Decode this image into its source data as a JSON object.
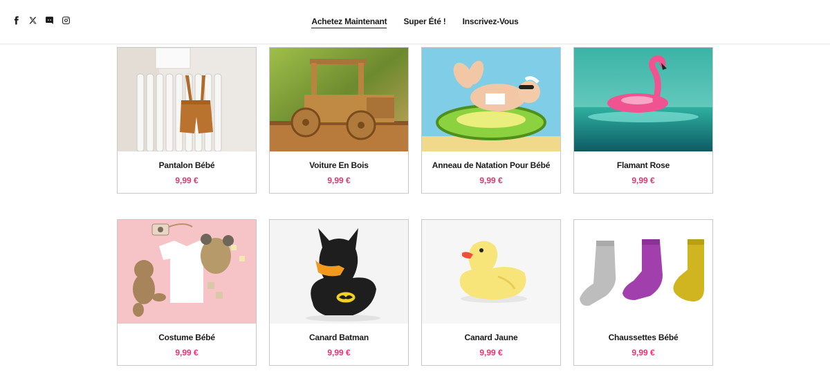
{
  "colors": {
    "price": "#e8336d",
    "text": "#1a1a1a",
    "border": "#c9c9c9"
  },
  "social": [
    {
      "icon": "facebook-icon"
    },
    {
      "icon": "x-twitter-icon"
    },
    {
      "icon": "discord-icon"
    },
    {
      "icon": "instagram-icon"
    }
  ],
  "nav": {
    "items": [
      {
        "label": "Achetez Maintenant",
        "active": true
      },
      {
        "label": "Super Été !"
      },
      {
        "label": "Inscrivez-Vous"
      }
    ]
  },
  "products": [
    {
      "name": "Pantalon Bébé",
      "price": "9,99 €",
      "image": "brown-shorts-on-radiator"
    },
    {
      "name": "Voiture En Bois",
      "price": "9,99 €",
      "image": "wooden-toy-truck"
    },
    {
      "name": "Anneau de Natation Pour Bébé",
      "price": "9,99 €",
      "image": "baby-on-swim-ring"
    },
    {
      "name": "Flamant Rose",
      "price": "9,99 €",
      "image": "pink-flamingo-float"
    },
    {
      "name": "Costume Bébé",
      "price": "9,99 €",
      "image": "baby-outfit-flatlay"
    },
    {
      "name": "Canard Batman",
      "price": "9,99 €",
      "image": "batman-rubber-duck"
    },
    {
      "name": "Canard Jaune",
      "price": "9,99 €",
      "image": "yellow-rubber-duck"
    },
    {
      "name": "Chaussettes Bébé",
      "price": "9,99 €",
      "image": "three-socks"
    }
  ]
}
